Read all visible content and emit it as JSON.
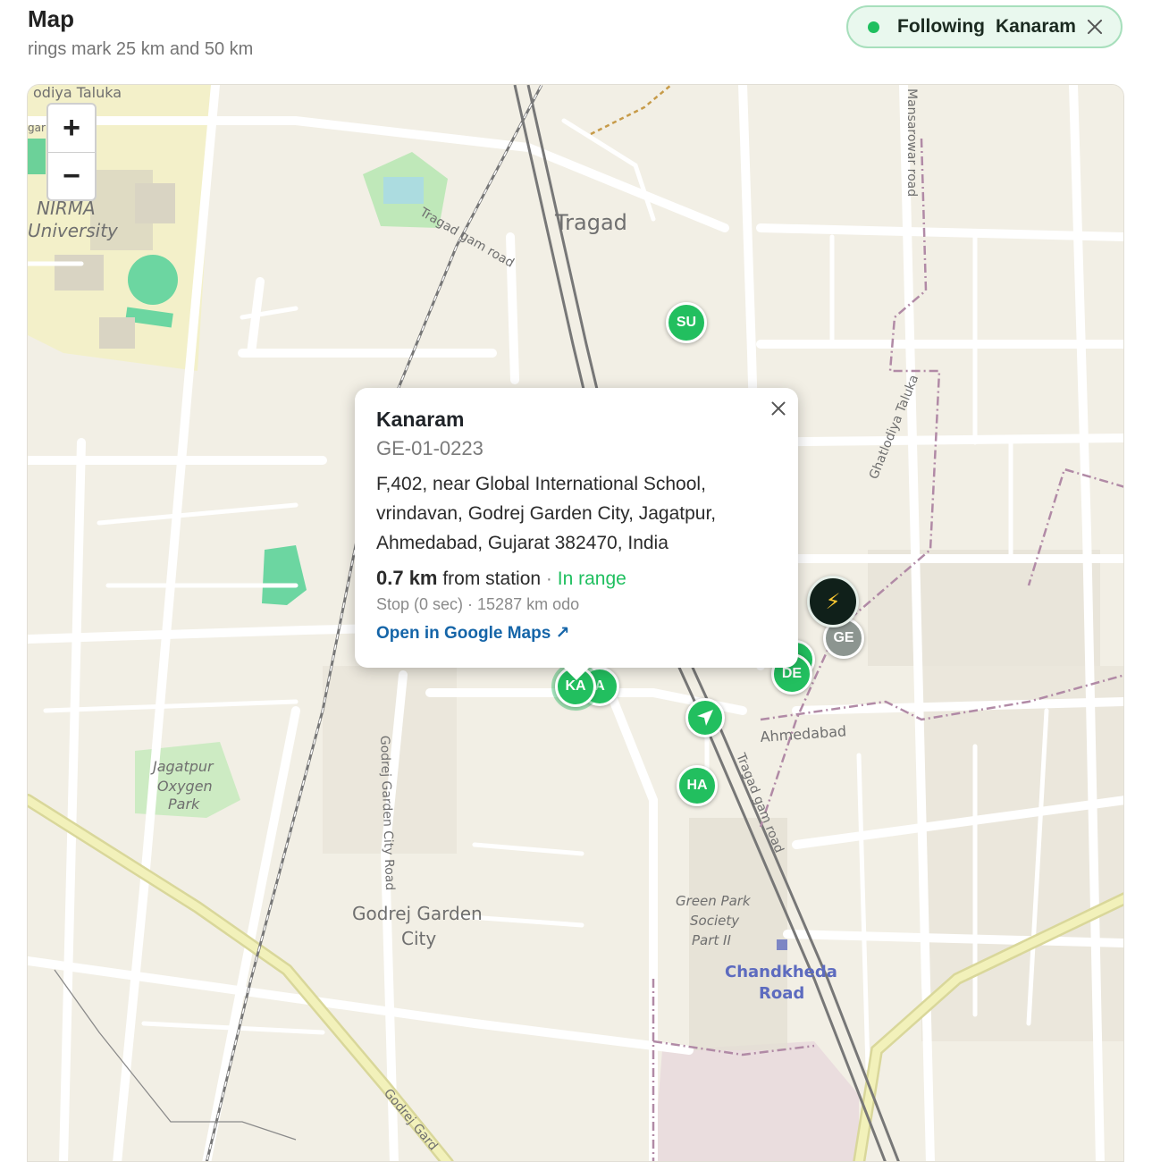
{
  "header": {
    "title": "Map",
    "subtitle": "rings mark 25 km and 50 km"
  },
  "follow_pill": {
    "label": "Following",
    "name": "Kanaram",
    "close_icon": "close-icon"
  },
  "zoom": {
    "in_label": "+",
    "out_label": "−"
  },
  "map_labels": {
    "taluka_top": "odiya Taluka",
    "gar": "gar",
    "nirma_1": "NIRMA",
    "nirma_2": "University",
    "tragad_gam_road": "Tragad gam road",
    "tragad": "Tragad",
    "mansarowar_road": "Mansarowar road",
    "ghatlodiya_taluka": "Ghatlodiya Taluka",
    "jagatpur_1": "Jagatpur",
    "jagatpur_2": "Oxygen",
    "jagatpur_3": "Park",
    "godrej_garden_city_road": "Godrej Garden City Road",
    "godrej_garden_1": "Godrej Garden",
    "godrej_garden_2": "City",
    "green_park_1": "Green Park",
    "green_park_2": "Society",
    "green_park_3": "Part II",
    "chandkheda_1": "Chandkheda",
    "chandkheda_2": "Road",
    "ahmedabad": "Ahmedabad",
    "tragad_gam_road_2": "Tragad gam road",
    "godrej_gard": "Godrej Gard"
  },
  "markers": [
    {
      "id": "su",
      "label": "SU"
    },
    {
      "id": "ka",
      "label": "KA"
    },
    {
      "id": "a",
      "label": "A"
    },
    {
      "id": "ha",
      "label": "HA"
    },
    {
      "id": "de",
      "label": "DE"
    },
    {
      "id": "ge",
      "label": "GE"
    },
    {
      "id": "station",
      "label": "",
      "icon": "bolt-icon"
    },
    {
      "id": "nav",
      "label": "",
      "icon": "navigation-arrow-icon"
    }
  ],
  "popup": {
    "name": "Kanaram",
    "code": "GE-01-0223",
    "address": "F,402, near Global International School, vrindavan, Godrej Garden City, Jagatpur, Ahmedabad, Gujarat 382470, India",
    "distance": "0.7 km",
    "distance_suffix": "from station",
    "separator": "·",
    "range_status": "In range",
    "status": "Stop (0 sec) · 15287 km odo",
    "link_label": "Open in Google Maps ↗"
  },
  "colors": {
    "accent_green": "#1fbf5f",
    "map_bg": "#f2efe5",
    "link_blue": "#1565a8"
  }
}
